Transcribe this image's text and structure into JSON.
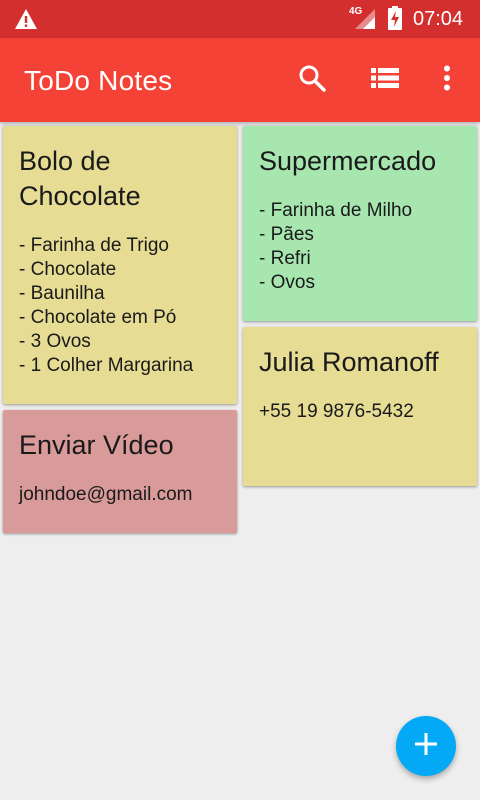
{
  "status_bar": {
    "network": "4G",
    "time": "07:04"
  },
  "app_bar": {
    "title": "ToDo Notes"
  },
  "notes": [
    {
      "title": "Bolo de Chocolate",
      "lines": [
        "- Farinha de Trigo",
        "- Chocolate",
        "- Baunilha",
        "- Chocolate em Pó",
        "- 3 Ovos",
        "- 1 Colher Margarina"
      ],
      "color": "#e6dc94"
    },
    {
      "title": "Supermercado",
      "lines": [
        "- Farinha de Milho",
        "- Pães",
        "- Refri",
        "- Ovos"
      ],
      "color": "#a8e6b0"
    },
    {
      "title": "Julia Romanoff",
      "lines": [
        "+55 19 9876-5432"
      ],
      "color": "#e6dc94"
    },
    {
      "title": "Enviar Vídeo",
      "lines": [
        "johndoe@gmail.com"
      ],
      "color": "#d99a9a"
    }
  ],
  "colors": {
    "status_bar": "#d32f2f",
    "app_bar": "#f44336",
    "fab": "#03a9f4"
  },
  "icons": [
    "warning-icon",
    "signal-icon",
    "battery-icon",
    "search-icon",
    "list-view-icon",
    "more-vert-icon",
    "add-icon"
  ]
}
